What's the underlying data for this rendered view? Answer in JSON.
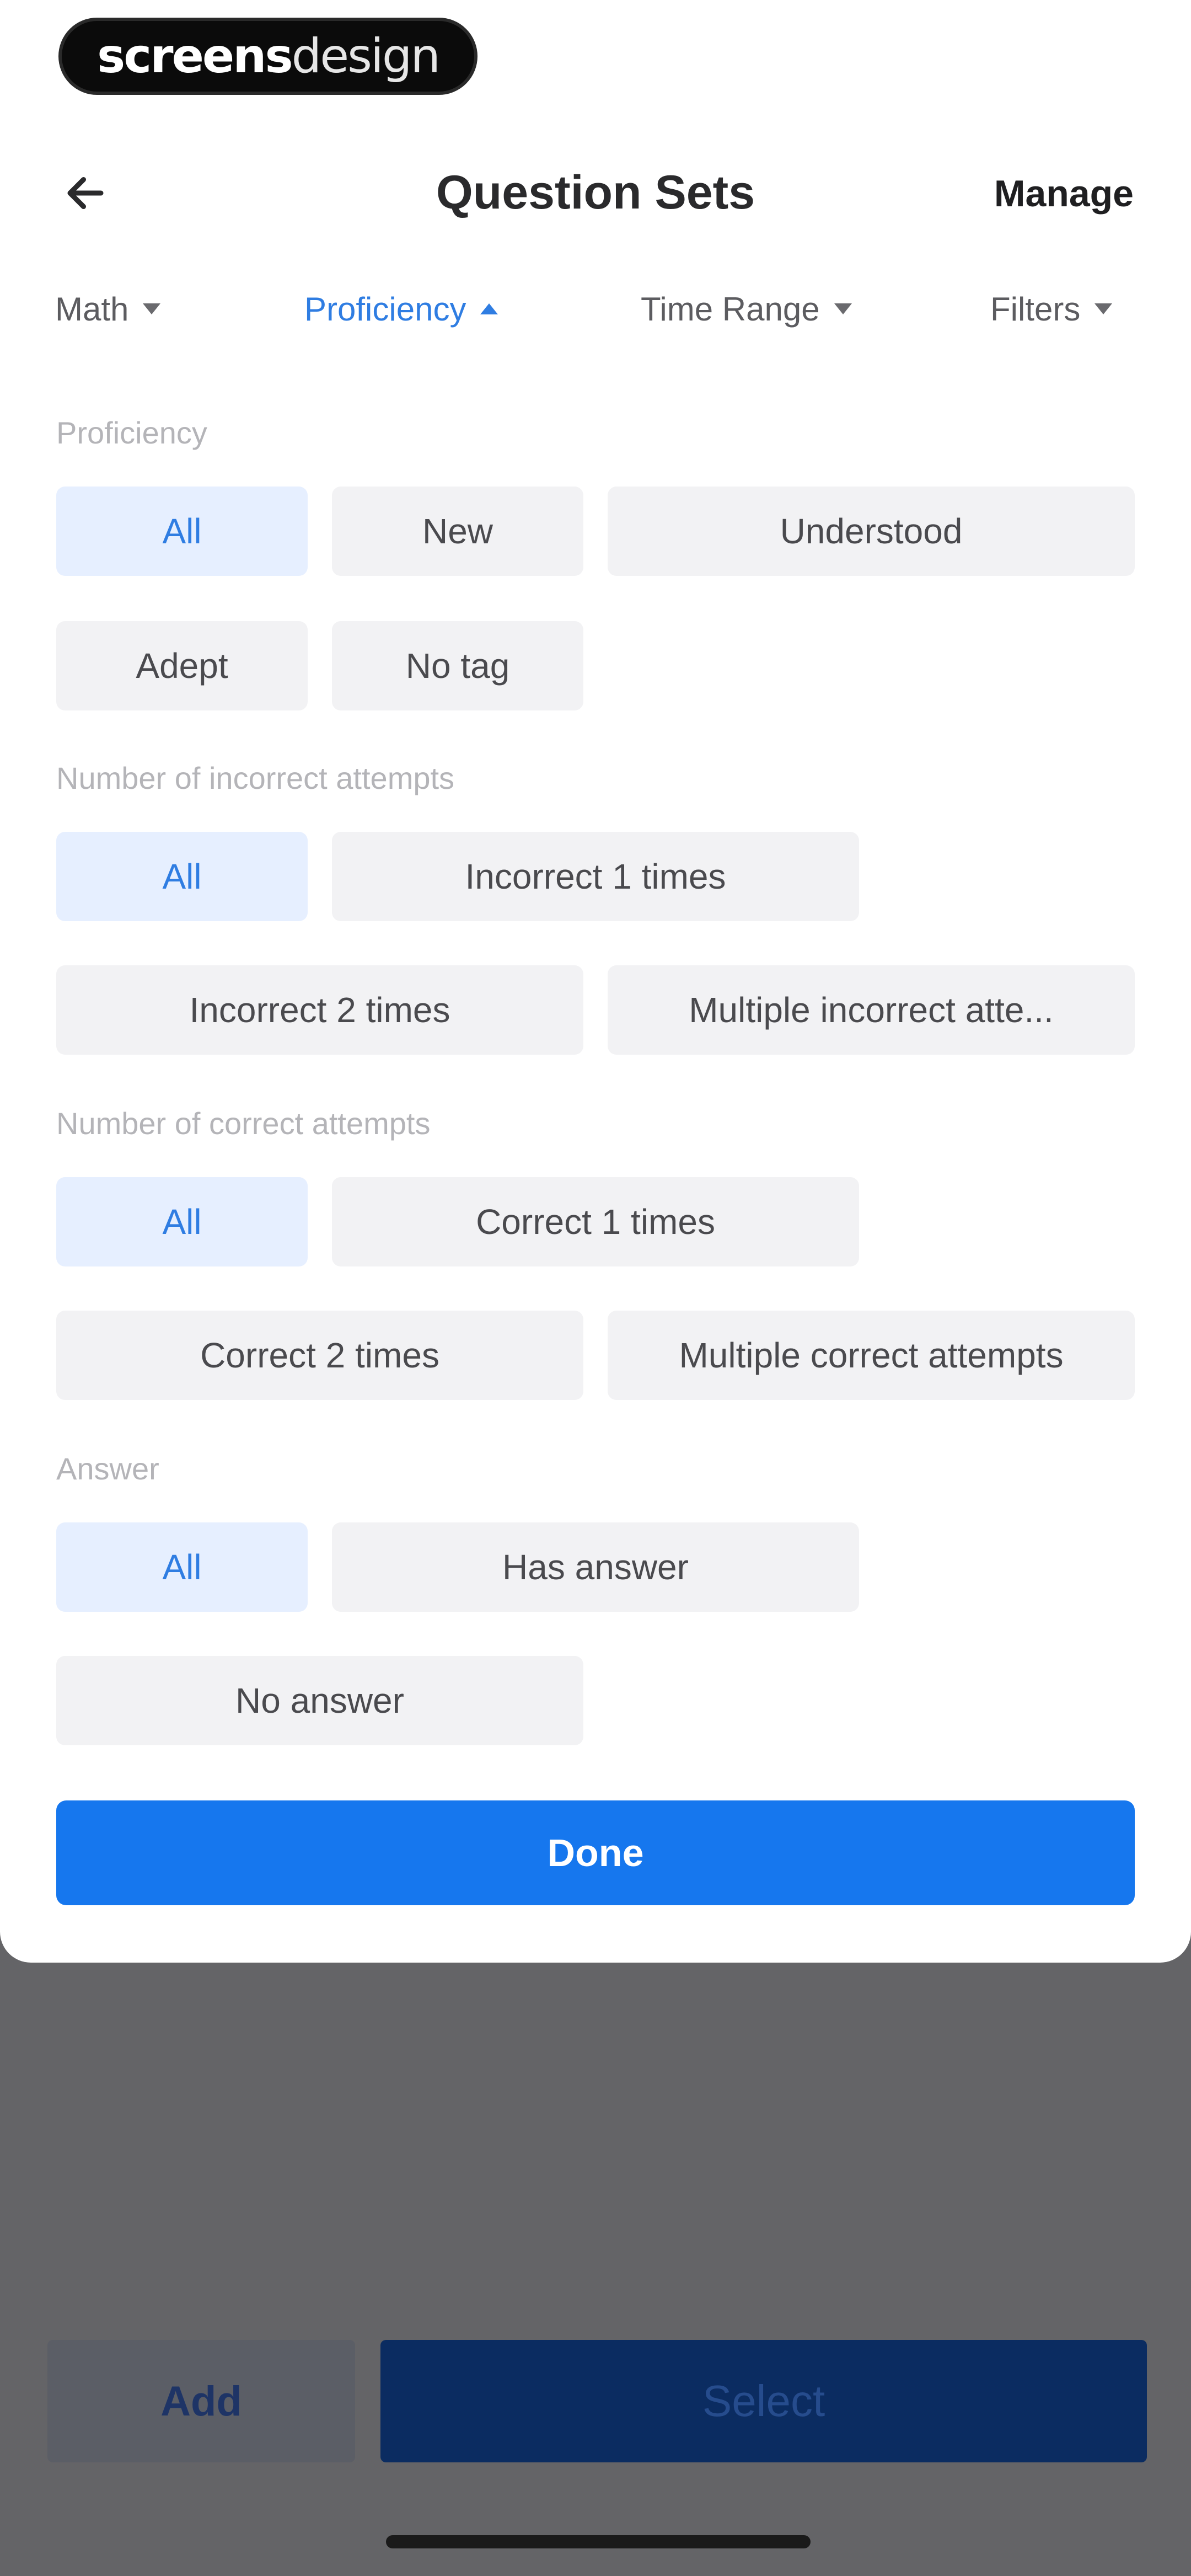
{
  "branding": {
    "logo_bold": "screens",
    "logo_light": "design"
  },
  "header": {
    "title": "Question Sets",
    "manage_label": "Manage",
    "back_icon": "arrow-left-icon"
  },
  "tabs": [
    {
      "label": "Math",
      "active": false
    },
    {
      "label": "Proficiency",
      "active": true
    },
    {
      "label": "Time Range",
      "active": false
    },
    {
      "label": "Filters",
      "active": false
    }
  ],
  "sections": {
    "proficiency": {
      "label": "Proficiency",
      "options": [
        "All",
        "New",
        "Understood",
        "Adept",
        "No tag"
      ],
      "selected": "All"
    },
    "incorrect": {
      "label": "Number of incorrect attempts",
      "options": [
        "All",
        "Incorrect 1 times",
        "Incorrect 2 times",
        "Multiple incorrect atte..."
      ],
      "selected": "All"
    },
    "correct": {
      "label": "Number of correct attempts",
      "options": [
        "All",
        "Correct 1 times",
        "Correct 2 times",
        "Multiple correct attempts"
      ],
      "selected": "All"
    },
    "answer": {
      "label": "Answer",
      "options": [
        "All",
        "Has answer",
        "No answer"
      ],
      "selected": "All"
    }
  },
  "actions": {
    "done_label": "Done",
    "add_label": "Add",
    "select_label": "Select"
  },
  "colors": {
    "accent": "#1677ee",
    "selected_bg": "#e6efff",
    "chip_bg": "#f2f2f4",
    "overlay": "#646467"
  }
}
